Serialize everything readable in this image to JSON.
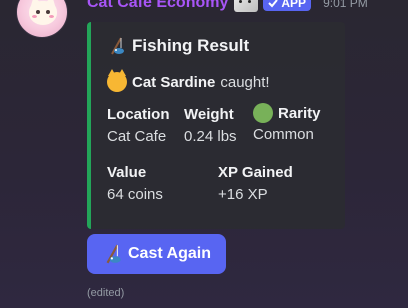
{
  "message": {
    "username": "Cat Cafe Economy",
    "app_badge": "APP",
    "timestamp": "9:01 PM",
    "edited_label": "(edited)"
  },
  "embed": {
    "accent_color": "#23a559",
    "title_icon": "fishing-rod-icon",
    "title": "Fishing Result",
    "description": {
      "icon": "cat-face-icon",
      "fish_name": "Cat Sardine",
      "suffix": "caught!"
    },
    "fields": [
      {
        "name": "Location",
        "value": "Cat Cafe"
      },
      {
        "name": "Weight",
        "value": "0.24 lbs"
      },
      {
        "name": "Rarity",
        "icon": "green-circle-icon",
        "value": "Common"
      },
      {
        "name": "Value",
        "value": "64 coins"
      },
      {
        "name": "XP Gained",
        "value": "+16 XP"
      }
    ]
  },
  "button": {
    "icon": "fishing-rod-icon",
    "label": "Cast Again",
    "color": "#5865f2"
  }
}
